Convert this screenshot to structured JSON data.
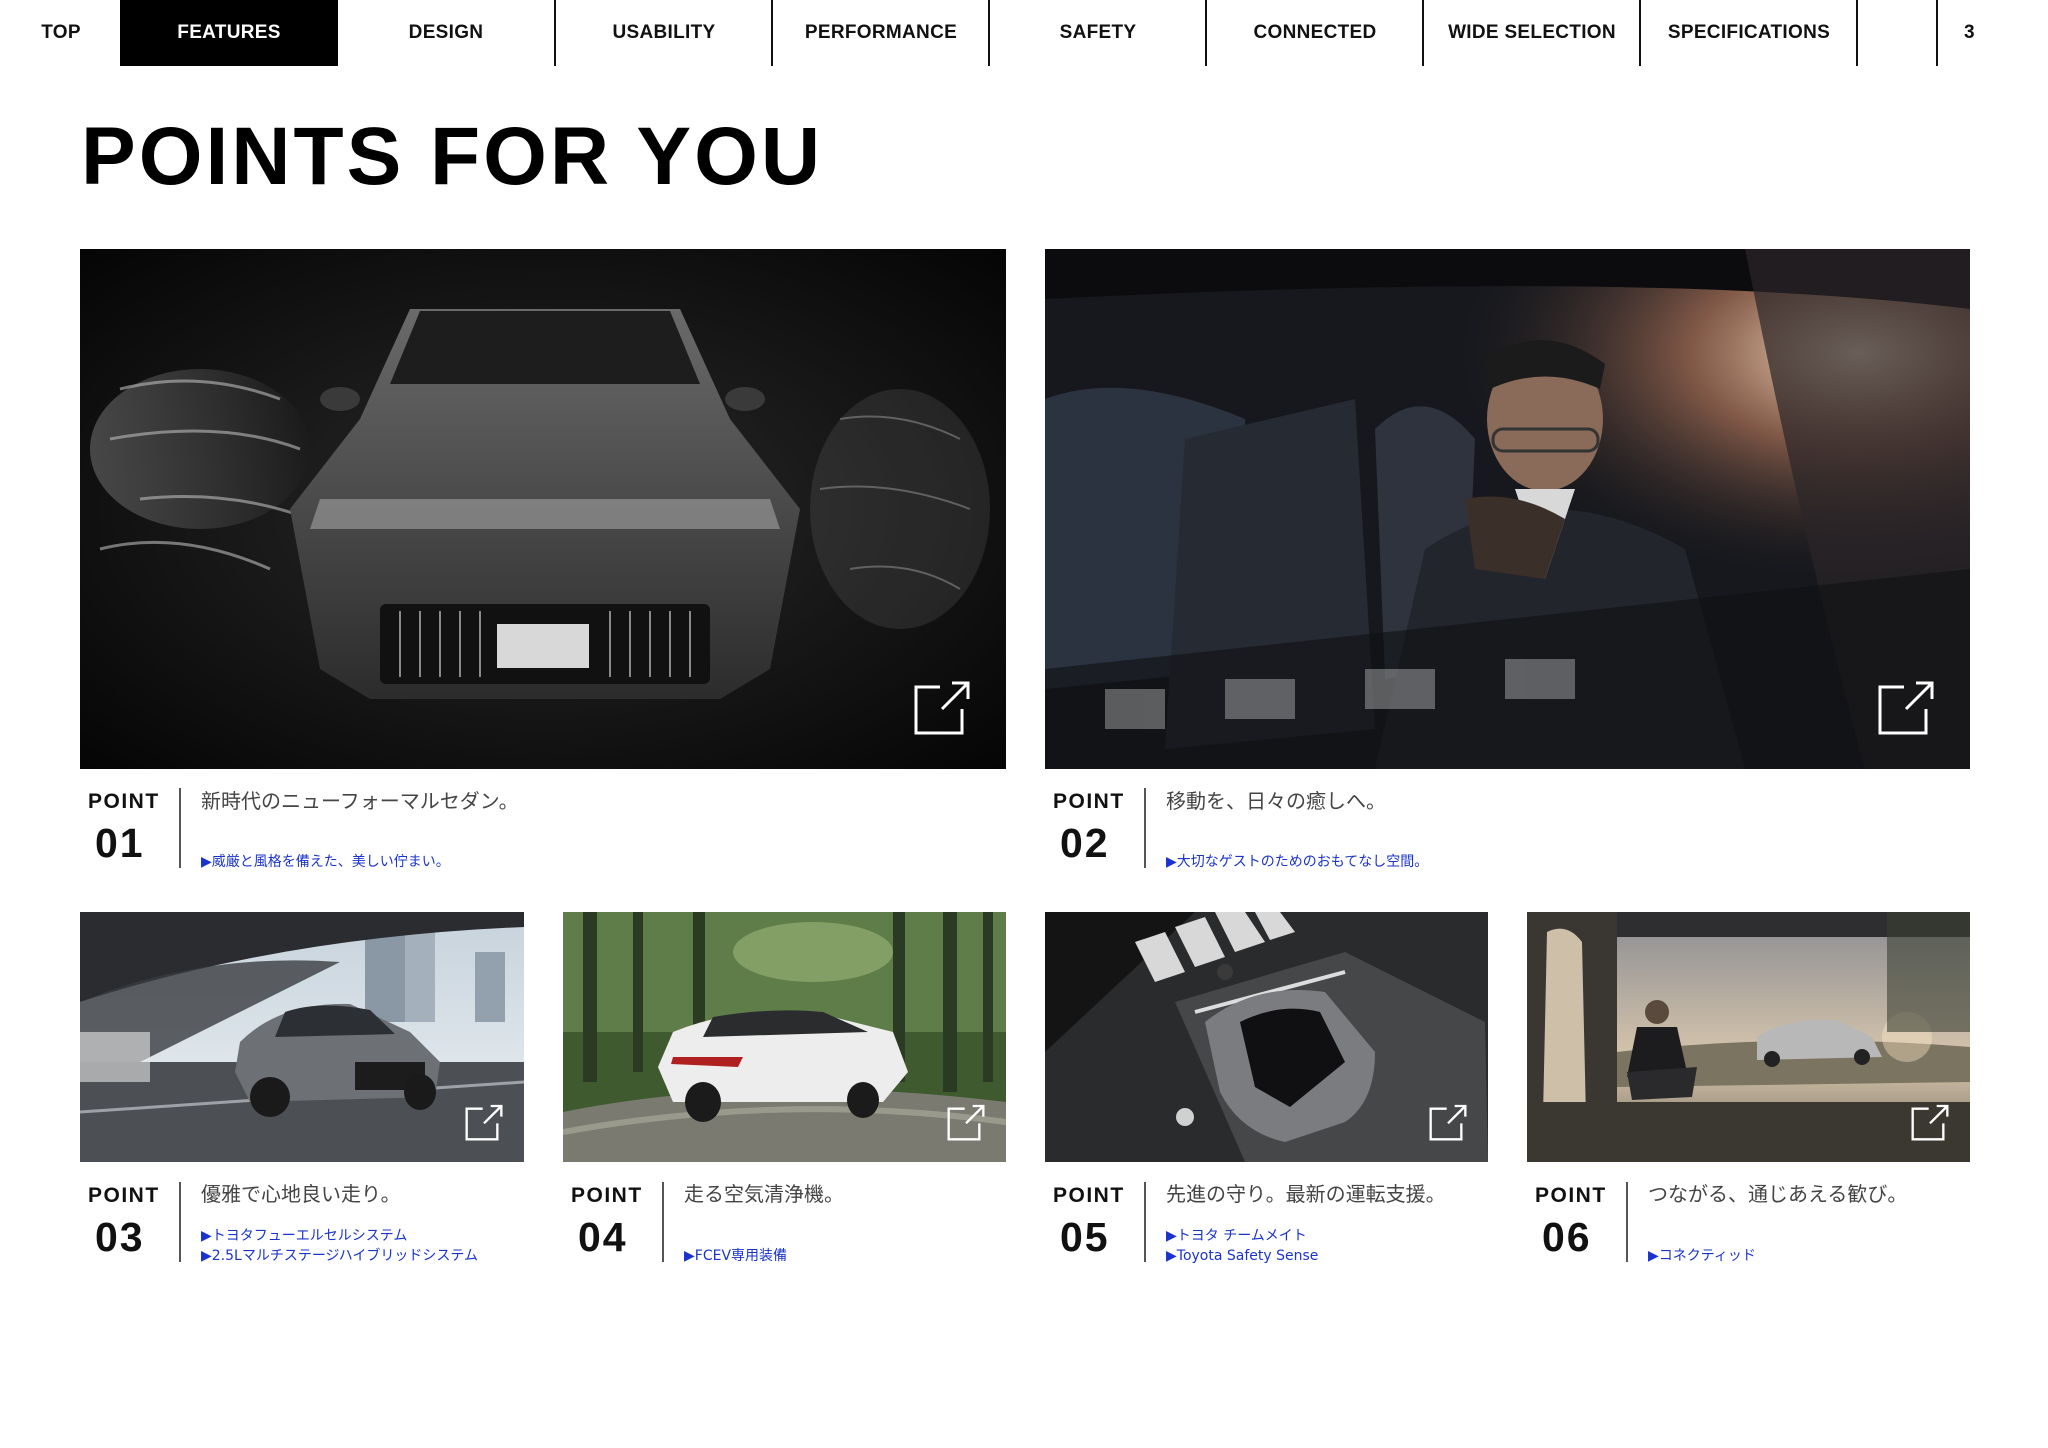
{
  "nav": {
    "items": [
      {
        "label": "TOP"
      },
      {
        "label": "FEATURES"
      },
      {
        "label": "DESIGN"
      },
      {
        "label": "USABILITY"
      },
      {
        "label": "PERFORMANCE"
      },
      {
        "label": "SAFETY"
      },
      {
        "label": "CONNECTED"
      },
      {
        "label": "WIDE SELECTION"
      },
      {
        "label": "SPECIFICATIONS"
      }
    ],
    "active": "FEATURES",
    "page_number": "3"
  },
  "title": "POINTS FOR YOU",
  "points": [
    {
      "label": "POINT",
      "number": "01",
      "headline": "新時代のニューフォーマルセダン。",
      "links": [
        "▶威厳と風格を備えた、美しい佇まい。"
      ],
      "image": "crown-front-on-water"
    },
    {
      "label": "POINT",
      "number": "02",
      "headline": "移動を、日々の癒しへ。",
      "links": [
        "▶大切なゲストのためのおもてなし空間。"
      ],
      "image": "passenger-in-rear-seat"
    },
    {
      "label": "POINT",
      "number": "03",
      "headline": "優雅で心地良い走り。",
      "links": [
        "▶トヨタフューエルセルシステム",
        "▶2.5Lマルチステージハイブリッドシステム"
      ],
      "image": "car-driving-city-highway"
    },
    {
      "label": "POINT",
      "number": "04",
      "headline": "走る空気清浄機。",
      "links": [
        "▶FCEV専用装備"
      ],
      "image": "car-driving-forest-road"
    },
    {
      "label": "POINT",
      "number": "05",
      "headline": "先進の守り。最新の運転支援。",
      "links": [
        "▶トヨタ チームメイト",
        "▶Toyota Safety Sense"
      ],
      "image": "car-top-view-crosswalk"
    },
    {
      "label": "POINT",
      "number": "06",
      "headline": "つながる、通じあえる歓び。",
      "links": [
        "▶コネクティッド"
      ],
      "image": "man-sitting-with-car-at-sunset"
    }
  ],
  "icons": {
    "external_link": "external-link-icon"
  },
  "colors": {
    "link": "#1a33cc",
    "nav_active_bg": "#000000",
    "text": "#111111"
  }
}
